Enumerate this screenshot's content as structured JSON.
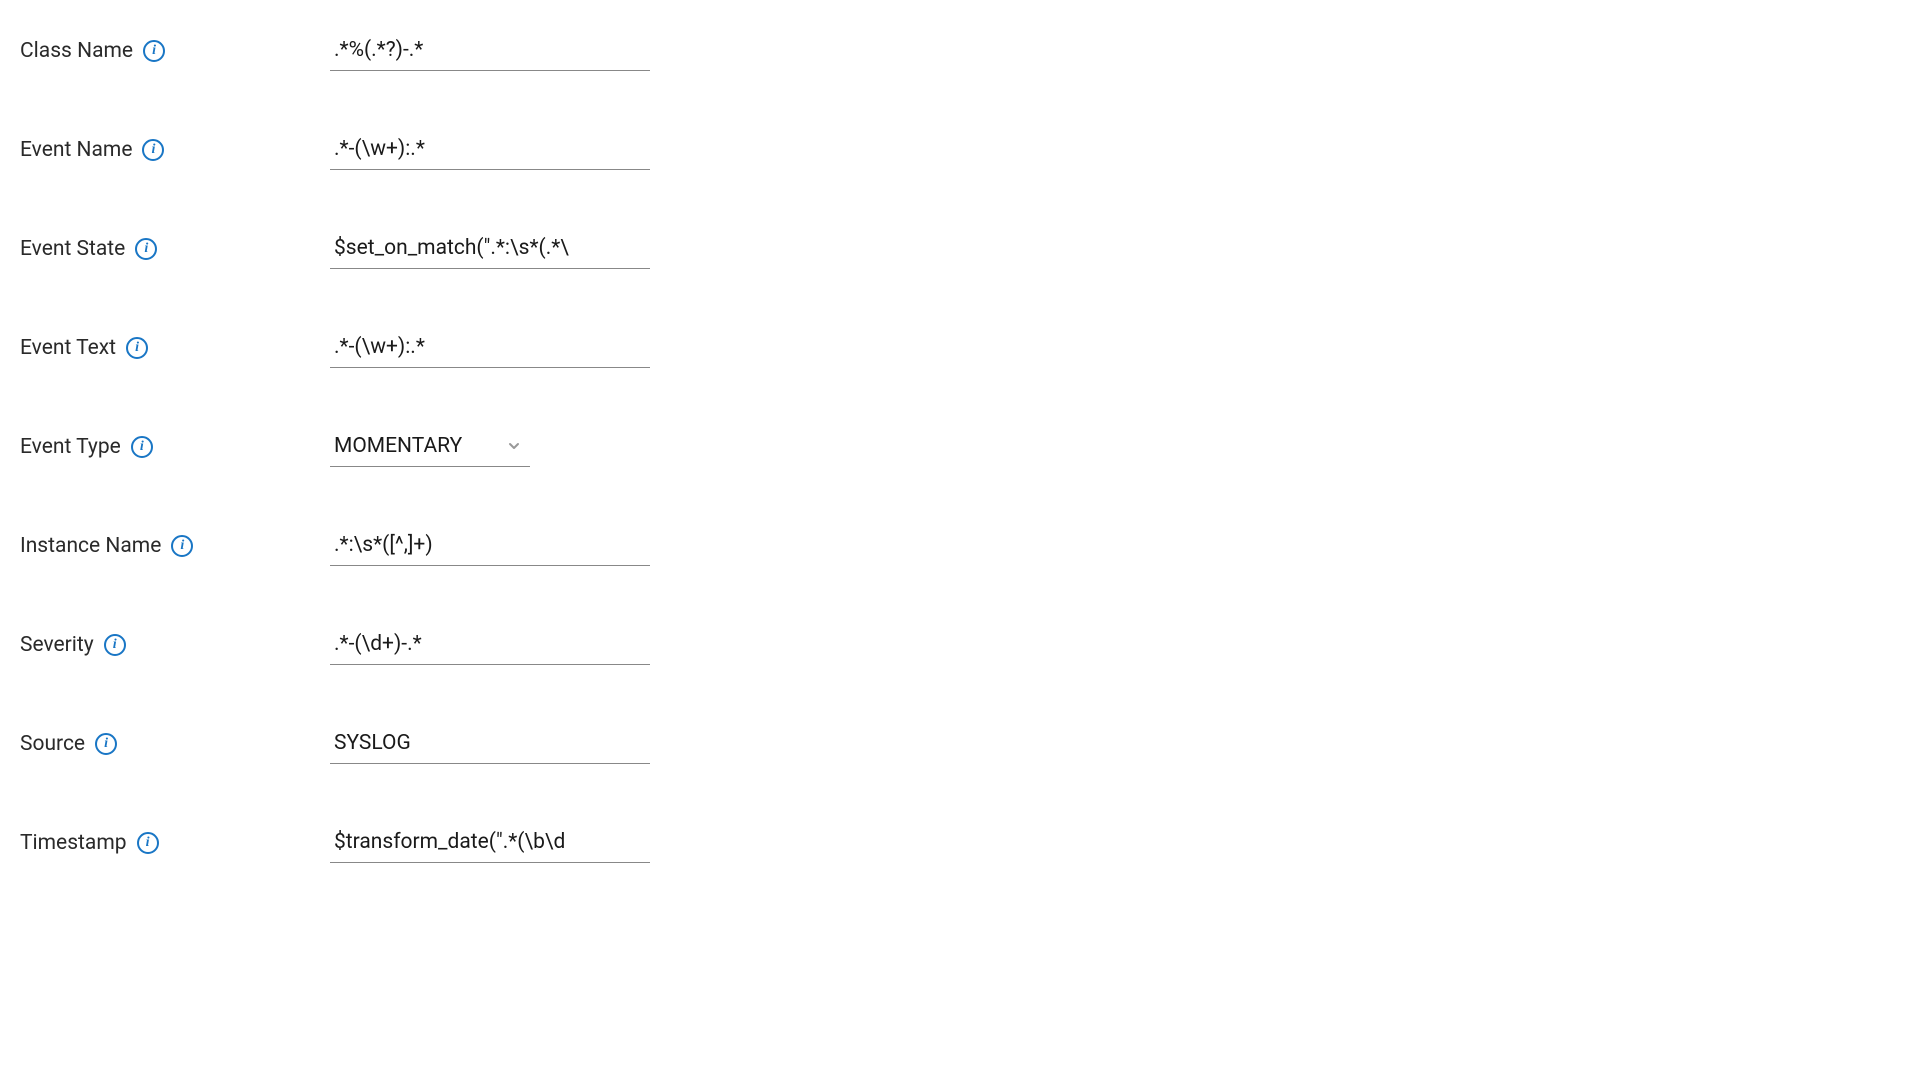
{
  "fields": {
    "className": {
      "label": "Class Name",
      "value": ".*%(.*?)-.*"
    },
    "eventName": {
      "label": "Event Name",
      "value": ".*-(\\w+):.*"
    },
    "eventState": {
      "label": "Event State",
      "value": "$set_on_match(\".*:\\s*(.*\\"
    },
    "eventText": {
      "label": "Event Text",
      "value": ".*-(\\w+):.*"
    },
    "eventType": {
      "label": "Event Type",
      "value": "MOMENTARY"
    },
    "instanceName": {
      "label": "Instance Name",
      "value": ".*:\\s*([^,]+)"
    },
    "severity": {
      "label": "Severity",
      "value": ".*-(\\d+)-.*"
    },
    "source": {
      "label": "Source",
      "value": "SYSLOG"
    },
    "timestamp": {
      "label": "Timestamp",
      "value": "$transform_date(\".*(\\b\\d"
    }
  },
  "infoIconGlyph": "i"
}
